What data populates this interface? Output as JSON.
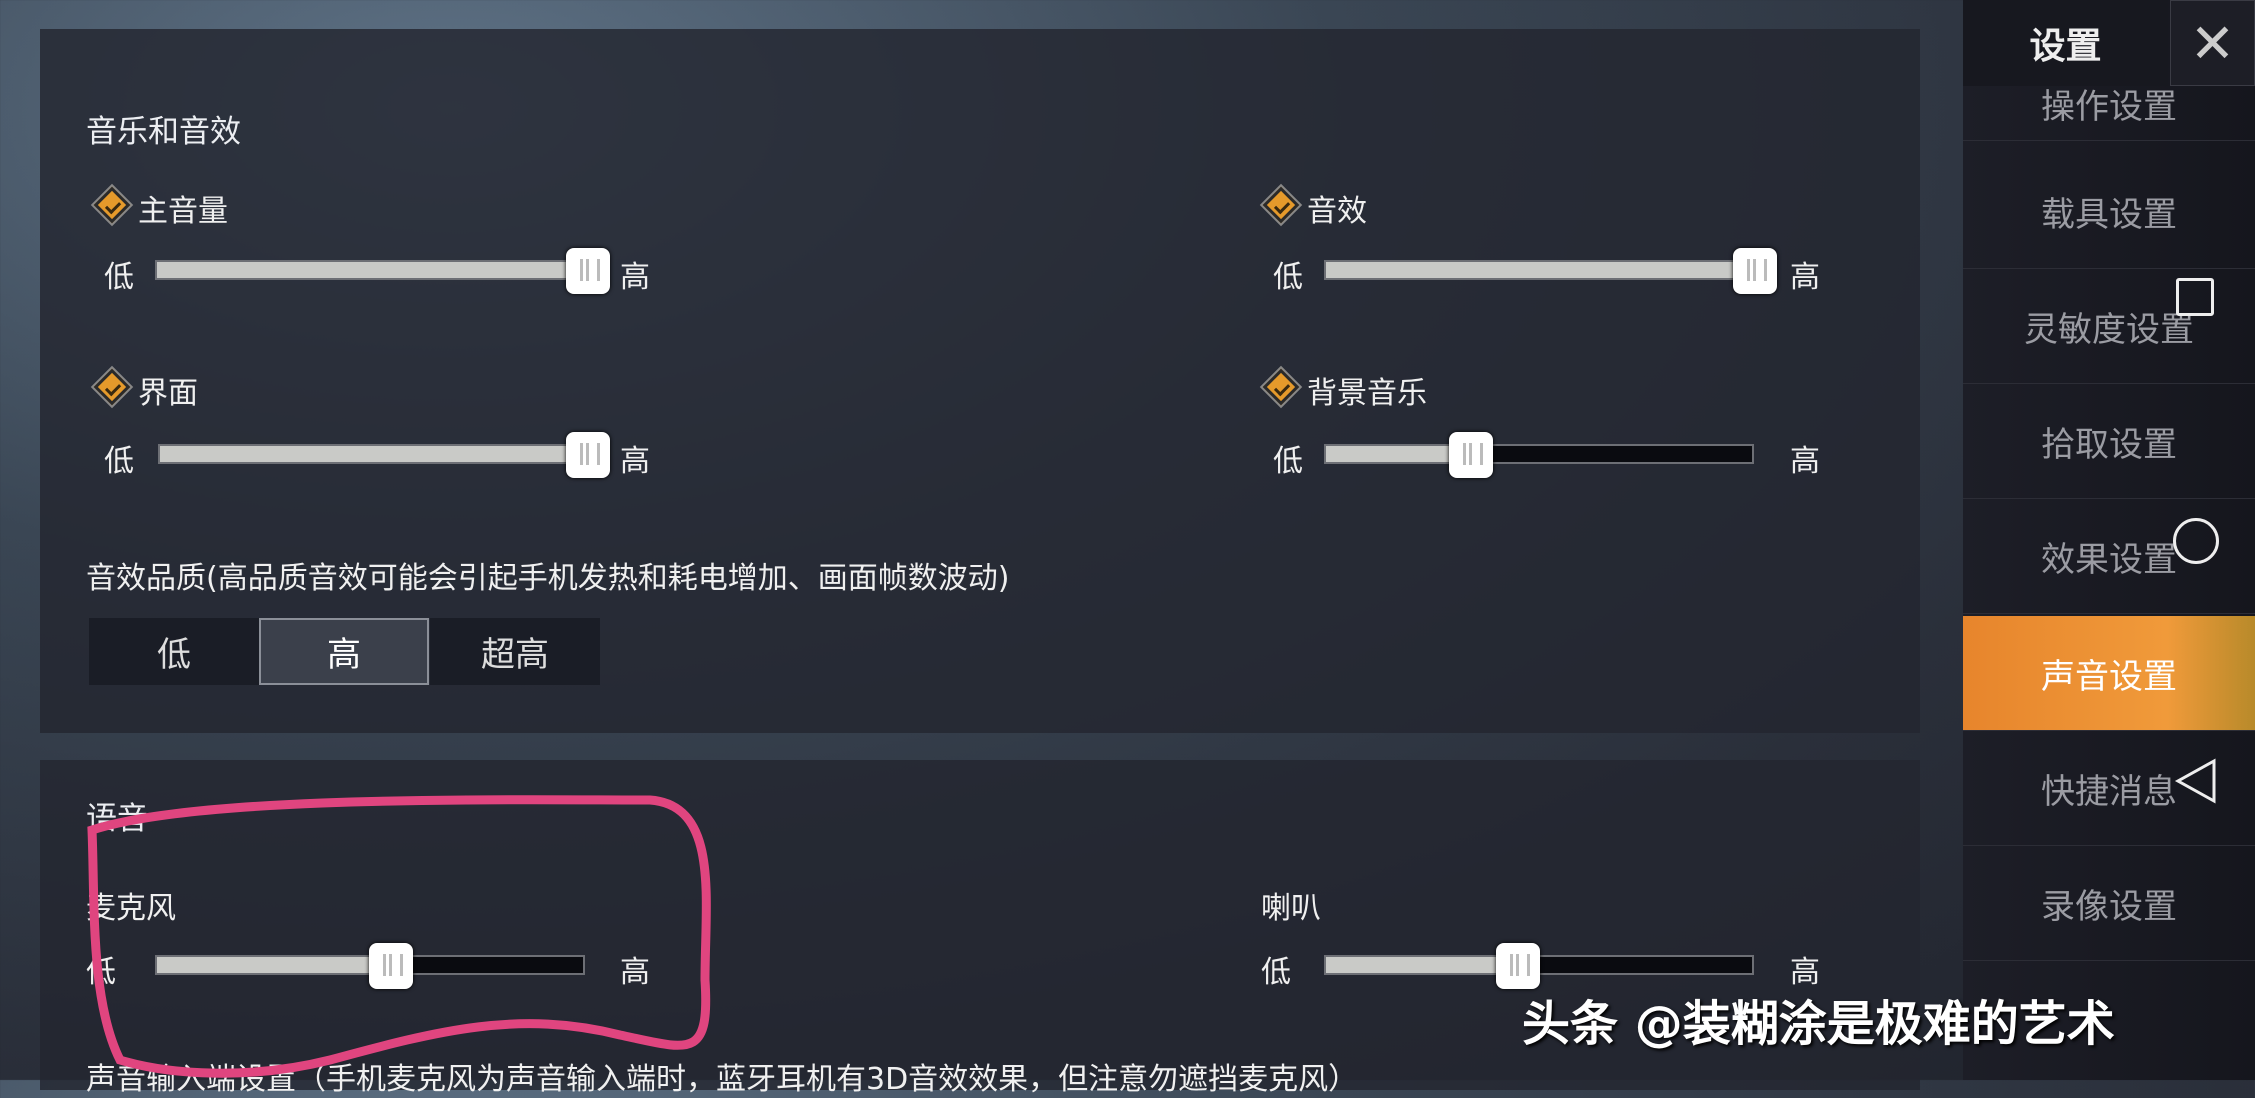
{
  "sidebar": {
    "title": "设置",
    "close_icon": "close-icon",
    "items": [
      {
        "label": "操作设置"
      },
      {
        "label": "载具设置"
      },
      {
        "label": "灵敏度设置"
      },
      {
        "label": "拾取设置"
      },
      {
        "label": "效果设置"
      },
      {
        "label": "声音设置",
        "active": true
      },
      {
        "label": "快捷消息"
      },
      {
        "label": "录像设置"
      }
    ],
    "accent": "#f0902f"
  },
  "music": {
    "title": "音乐和音效",
    "low": "低",
    "high": "高",
    "sliders": [
      {
        "label": "主音量",
        "value": 1.0,
        "checked": true
      },
      {
        "label": "音效",
        "value": 1.0,
        "checked": true
      },
      {
        "label": "界面",
        "value": 1.0,
        "checked": true
      },
      {
        "label": "背景音乐",
        "value": 0.34,
        "checked": true
      }
    ],
    "quality_label": "音效品质(高品质音效可能会引起手机发热和耗电增加、画面帧数波动)",
    "quality_options": [
      "低",
      "高",
      "超高"
    ],
    "quality_selected": "高"
  },
  "voice": {
    "title": "语音",
    "low": "低",
    "high": "高",
    "sliders": [
      {
        "label": "麦克风",
        "value": 0.55
      },
      {
        "label": "喇叭",
        "value": 0.45
      }
    ],
    "input_label": "声音输入端设置（手机麦克风为声音输入端时，蓝牙耳机有3D音效效果，但注意勿遮挡麦克风）"
  },
  "watermark": "头条 @装糊涂是极难的艺术",
  "nav_overlay": [
    "square-icon",
    "circle-icon",
    "triangle-back-icon"
  ]
}
